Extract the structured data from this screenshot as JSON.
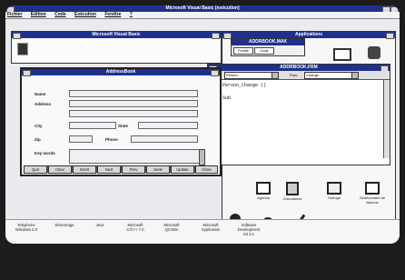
{
  "main_title": "Microsoft Visual Basic [exécution]",
  "menu": [
    "Fichier",
    "Edition",
    "Code",
    "Exécution",
    "Fenêtre",
    "?"
  ],
  "vb_title": "Microsoft Visual Basic",
  "apps_title": "Applications",
  "project": {
    "title": "ADDRBOOK.MAK",
    "view_form": "Feuille",
    "view_code": "Code"
  },
  "code": {
    "title": "ADDRBOOK.FRM",
    "object_label": "Objet",
    "object_value": "Person",
    "proc_label": "Proc.",
    "proc_value": "Change",
    "lines": [
      "Sub Person_Change ()",
      "",
      "End Sub"
    ]
  },
  "form": {
    "title": "AddressBook",
    "labels": {
      "name": "Name",
      "address": "Address",
      "city": "City",
      "state": "State",
      "zip": "Zip",
      "phone": "Phone",
      "keywords": "Key words"
    },
    "buttons": [
      "Quit",
      "Clear",
      "Insert",
      "Next",
      "Prev",
      "Seek",
      "Update",
      "Close"
    ]
  },
  "app_icons": [
    "Agenda",
    "Calculatrice",
    "Horloge",
    "Gestionnaire de liaisons"
  ],
  "taskbar": [
    {
      "name": "Windows 2.0",
      "label": "Telephone\nWindows 2.0"
    },
    {
      "name": "demarrage",
      "label": "Démarrage"
    },
    {
      "name": "jeux",
      "label": "Jeux"
    },
    {
      "name": "cpp",
      "label": "Microsoft\nC/C++ 7.0"
    },
    {
      "name": "qcwin",
      "label": "Microsoft\nQC/Win"
    },
    {
      "name": "application",
      "label": "Microsoft\nApplication"
    },
    {
      "name": "software-dev",
      "label": "Software\nDevelopment\nKit 3.1"
    }
  ],
  "colors": {
    "titlebar": "#1f2f8c",
    "panel": "#d7d8da",
    "field": "#eef0f3",
    "taskbar": "#f5f6f7"
  }
}
